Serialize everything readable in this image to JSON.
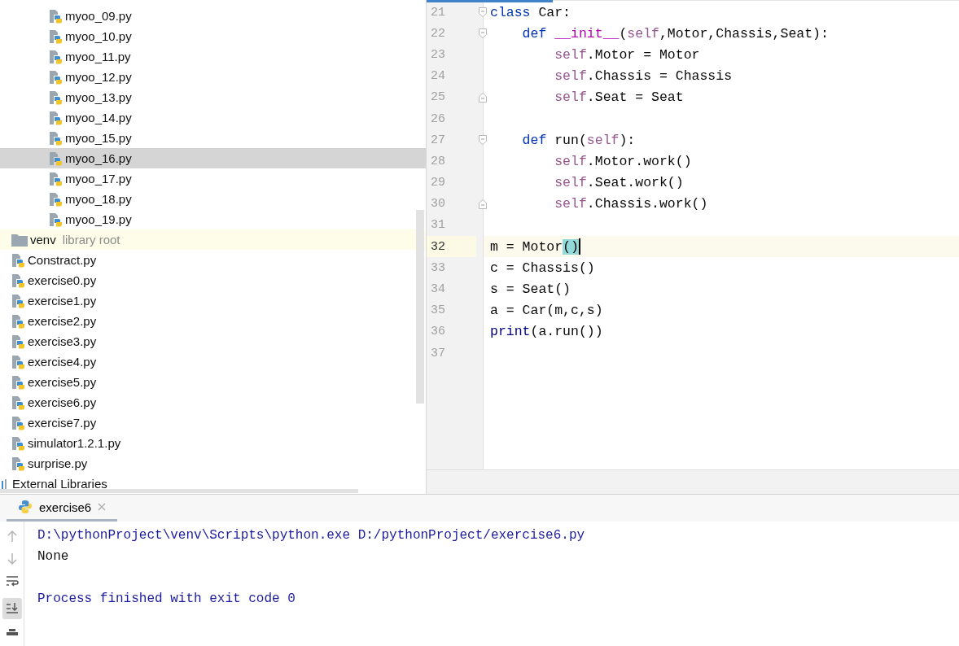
{
  "project_tree": {
    "items": [
      {
        "kind": "group",
        "children": [
          {
            "kind": "python-file",
            "label": "myoo_09.py",
            "selected": false
          },
          {
            "kind": "python-file",
            "label": "myoo_10.py",
            "selected": false
          },
          {
            "kind": "python-file",
            "label": "myoo_11.py",
            "selected": false
          },
          {
            "kind": "python-file",
            "label": "myoo_12.py",
            "selected": false
          },
          {
            "kind": "python-file",
            "label": "myoo_13.py",
            "selected": false
          },
          {
            "kind": "python-file",
            "label": "myoo_14.py",
            "selected": false
          },
          {
            "kind": "python-file",
            "label": "myoo_15.py",
            "selected": false
          },
          {
            "kind": "python-file",
            "label": "myoo_16.py",
            "selected": true
          },
          {
            "kind": "python-file",
            "label": "myoo_17.py",
            "selected": false
          },
          {
            "kind": "python-file",
            "label": "myoo_18.py",
            "selected": false
          },
          {
            "kind": "python-file",
            "label": "myoo_19.py",
            "selected": false
          }
        ]
      },
      {
        "kind": "folder",
        "label": "venv",
        "note": "library root",
        "selected": false
      },
      {
        "kind": "python-file",
        "label": "Constract.py",
        "selected": false
      },
      {
        "kind": "python-file",
        "label": "exercise0.py",
        "selected": false
      },
      {
        "kind": "python-file",
        "label": "exercise1.py",
        "selected": false
      },
      {
        "kind": "python-file",
        "label": "exercise2.py",
        "selected": false
      },
      {
        "kind": "python-file",
        "label": "exercise3.py",
        "selected": false
      },
      {
        "kind": "python-file",
        "label": "exercise4.py",
        "selected": false
      },
      {
        "kind": "python-file",
        "label": "exercise5.py",
        "selected": false
      },
      {
        "kind": "python-file",
        "label": "exercise6.py",
        "selected": false
      },
      {
        "kind": "python-file",
        "label": "exercise7.py",
        "selected": false
      },
      {
        "kind": "python-file",
        "label": "simulator1.2.1.py",
        "selected": false
      },
      {
        "kind": "python-file",
        "label": "surprise.py",
        "selected": false
      },
      {
        "kind": "libraries",
        "label": "External Libraries",
        "selected": false
      }
    ]
  },
  "editor": {
    "lines": [
      {
        "number": "21",
        "fold_open": true,
        "current": false,
        "tokens": [
          {
            "kind": "keyword",
            "text": "class"
          },
          {
            "kind": "plain",
            "text": " Car:"
          }
        ]
      },
      {
        "number": "22",
        "fold_open": true,
        "current": false,
        "tokens": [
          {
            "kind": "keyword",
            "text": "    def "
          },
          {
            "kind": "magic",
            "text": "__init__"
          },
          {
            "kind": "plain",
            "text": "("
          },
          {
            "kind": "self",
            "text": "self"
          },
          {
            "kind": "plain",
            "text": ",Motor,Chassis,Seat):"
          }
        ]
      },
      {
        "number": "23",
        "current": false,
        "tokens": [
          {
            "kind": "self",
            "text": "        self"
          },
          {
            "kind": "plain",
            "text": ".Motor = Motor"
          }
        ]
      },
      {
        "number": "24",
        "current": false,
        "tokens": [
          {
            "kind": "self",
            "text": "        self"
          },
          {
            "kind": "plain",
            "text": ".Chassis = Chassis"
          }
        ]
      },
      {
        "number": "25",
        "fold_open": false,
        "current": false,
        "tokens": [
          {
            "kind": "self",
            "text": "        self"
          },
          {
            "kind": "plain",
            "text": ".Seat = Seat"
          }
        ]
      },
      {
        "number": "26",
        "current": false
      },
      {
        "number": "27",
        "fold_open": true,
        "current": false,
        "tokens": [
          {
            "kind": "keyword",
            "text": "    def"
          },
          {
            "kind": "plain",
            "text": " run("
          },
          {
            "kind": "self",
            "text": "self"
          },
          {
            "kind": "plain",
            "text": "):"
          }
        ]
      },
      {
        "number": "28",
        "current": false,
        "tokens": [
          {
            "kind": "self",
            "text": "        self"
          },
          {
            "kind": "plain",
            "text": ".Motor.work()"
          }
        ]
      },
      {
        "number": "29",
        "current": false,
        "tokens": [
          {
            "kind": "self",
            "text": "        self"
          },
          {
            "kind": "plain",
            "text": ".Seat.work()"
          }
        ]
      },
      {
        "number": "30",
        "fold_open": false,
        "current": false,
        "tokens": [
          {
            "kind": "self",
            "text": "        self"
          },
          {
            "kind": "plain",
            "text": ".Chassis.work()"
          }
        ]
      },
      {
        "number": "31",
        "current": false
      },
      {
        "number": "32",
        "current": true,
        "tokens": [
          {
            "kind": "plain",
            "text": "m = Motor"
          },
          {
            "kind": "match",
            "text": "()"
          }
        ]
      },
      {
        "number": "33",
        "current": false,
        "tokens": [
          {
            "kind": "plain",
            "text": "c = Chassis()"
          }
        ]
      },
      {
        "number": "34",
        "current": false,
        "tokens": [
          {
            "kind": "plain",
            "text": "s = Seat()"
          }
        ]
      },
      {
        "number": "35",
        "current": false,
        "tokens": [
          {
            "kind": "plain",
            "text": "a = Car(m,c,s)"
          }
        ]
      },
      {
        "number": "36",
        "current": false,
        "tokens": [
          {
            "kind": "builtin",
            "text": "print"
          },
          {
            "kind": "plain",
            "text": "(a.run())"
          }
        ]
      },
      {
        "number": "37",
        "current": false
      }
    ]
  },
  "run_panel": {
    "tabs": [
      {
        "label": "exercise6",
        "selected": true
      }
    ],
    "console": [
      {
        "kind": "system",
        "text": "D:\\pythonProject\\venv\\Scripts\\python.exe D:/pythonProject/exercise6.py"
      },
      {
        "kind": "output",
        "text": "None"
      },
      {
        "kind": "blank"
      },
      {
        "kind": "system",
        "text": "Process finished with exit code 0"
      }
    ]
  }
}
